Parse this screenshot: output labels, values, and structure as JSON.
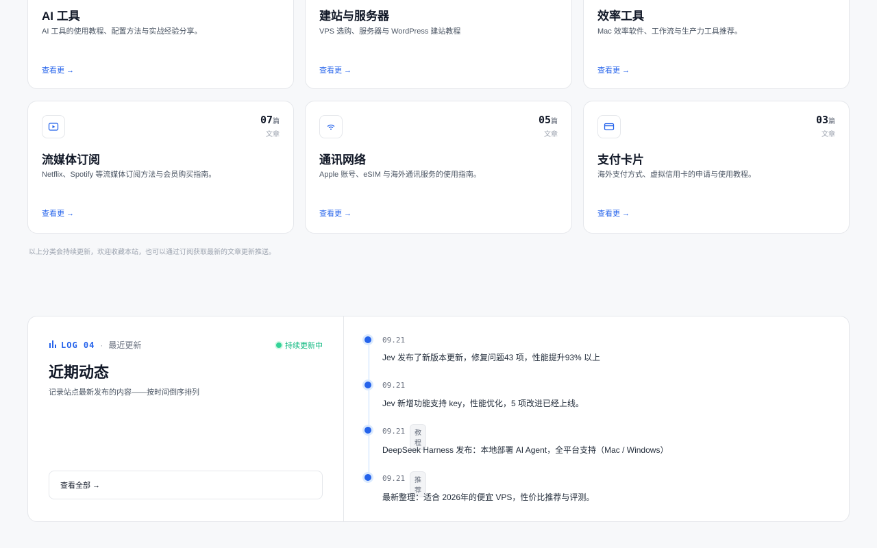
{
  "cards": [
    {
      "title": "AI 工具",
      "desc": "AI 工具的使用教程、配置方法与实战经验分享。",
      "link": "查看更 →"
    },
    {
      "title": "建站与服务器",
      "desc": "VPS 选购、服务器与 WordPress 建站教程",
      "link": "查看更 →"
    },
    {
      "title": "效率工具",
      "desc": "Mac 效率软件、工作流与生产力工具推荐。",
      "link": "查看更 →"
    },
    {
      "title": "流媒体订阅",
      "desc": "Netflix、Spotify 等流媒体订阅方法与会员购买指南。",
      "link": "查看更 →",
      "count": "07",
      "unit": "篇",
      "count_label": "文章",
      "icon": "play-icon"
    },
    {
      "title": "通讯网络",
      "desc": "Apple 账号、eSIM 与海外通讯服务的使用指南。",
      "link": "查看更 →",
      "count": "05",
      "unit": "篇",
      "count_label": "文章",
      "icon": "wifi-icon"
    },
    {
      "title": "支付卡片",
      "desc": "海外支付方式、虚拟信用卡的申请与使用教程。",
      "link": "查看更 →",
      "count": "03",
      "unit": "篇",
      "count_label": "文章",
      "icon": "credit-card-icon"
    }
  ],
  "footnote": "以上分类会持续更新，欢迎收藏本站，也可以通过订阅获取最新的文章更新推送。",
  "log": {
    "code": "LOG 04",
    "separator": "·",
    "subtitle": "最近更新",
    "status": "持续更新中",
    "title": "近期动态",
    "desc": "记录站点最新发布的内容——按时间倒序排列",
    "button": "查看全部 →",
    "items": [
      {
        "date": "09.21",
        "badge": "",
        "text": "Jev 发布了新版本更新，修复问题43 项，性能提升93% 以上"
      },
      {
        "date": "09.21",
        "badge": "",
        "text": "Jev 新增功能支持 key，性能优化，5 项改进已经上线。"
      },
      {
        "date": "09.21",
        "badge": "教程",
        "text": "DeepSeek Harness 发布：本地部署 AI Agent，全平台支持（Mac / Windows）"
      },
      {
        "date": "09.21",
        "badge": "推荐",
        "text": "最新整理：适合 2026年的便宜 VPS，性价比推荐与评测。"
      }
    ]
  },
  "colors": {
    "accent": "#2563eb",
    "status": "#10b981",
    "border": "#e5e7eb"
  }
}
